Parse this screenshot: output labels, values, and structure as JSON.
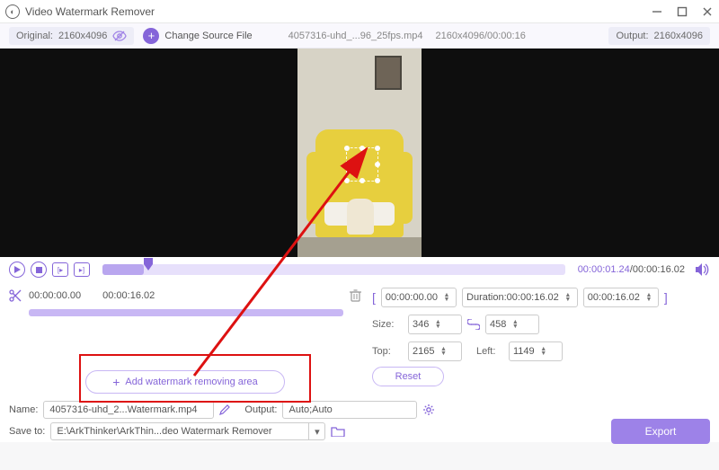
{
  "window": {
    "title": "Video Watermark Remover"
  },
  "toolbar": {
    "original_label": "Original:",
    "original_res": "2160x4096",
    "change_source": "Change Source File",
    "file_name": "4057316-uhd_...96_25fps.mp4",
    "file_res_time": "2160x4096/00:00:16",
    "output_label": "Output:",
    "output_res": "2160x4096"
  },
  "player": {
    "current": "00:00:01.24",
    "duration": "00:00:16.02"
  },
  "range": {
    "start": "00:00:00.00",
    "end": "00:00:16.02"
  },
  "right": {
    "bracket_start": "00:00:00.00",
    "duration_label": "Duration:",
    "duration_val": "00:00:16.02",
    "bracket_end": "00:00:16.02",
    "size_label": "Size:",
    "size_w": "346",
    "size_h": "458",
    "top_label": "Top:",
    "top_val": "2165",
    "left_label": "Left:",
    "left_val": "1149",
    "reset": "Reset"
  },
  "add_area_btn": "Add watermark removing area",
  "bottom": {
    "name_label": "Name:",
    "name_val": "4057316-uhd_2...Watermark.mp4",
    "output_label": "Output:",
    "output_val": "Auto;Auto",
    "save_label": "Save to:",
    "save_val": "E:\\ArkThinker\\ArkThin...deo Watermark Remover",
    "export": "Export"
  }
}
